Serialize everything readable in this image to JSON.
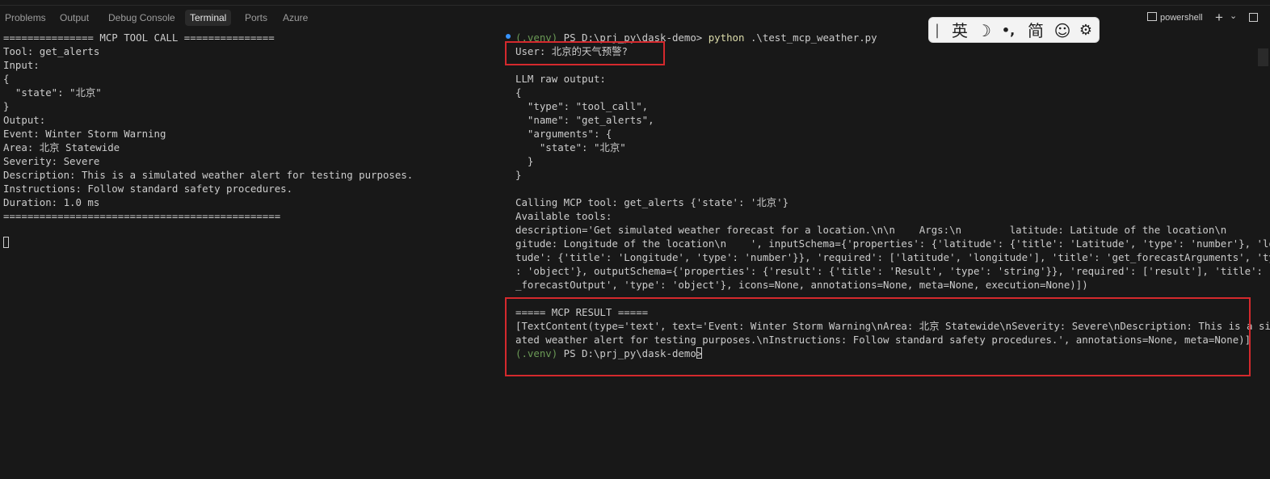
{
  "panel_tabs": [
    "Problems",
    "Output",
    "Debug Console",
    "Terminal",
    "Ports",
    "Azure"
  ],
  "toolbar": {
    "terminal_name": "powershell",
    "add_label": "+",
    "dropdown_label": "⌄",
    "layout_icon": "panel-layout-icon"
  },
  "ime": {
    "lang": "英",
    "moon": "☽",
    "punct": "•,",
    "simplified": "简",
    "emoji": "☺",
    "settings": "⚙"
  },
  "left_terminal": {
    "lines": [
      "=============== MCP TOOL CALL ===============",
      "Tool: get_alerts",
      "Input:",
      "{",
      "  \"state\": \"北京\"",
      "}",
      "Output:",
      "Event: Winter Storm Warning",
      "Area: 北京 Statewide",
      "Severity: Severe",
      "Description: This is a simulated weather alert for testing purposes.",
      "Instructions: Follow standard safety procedures.",
      "Duration: 1.0 ms",
      "=============================================="
    ]
  },
  "right_terminal": {
    "prompt_venv": "(.venv)",
    "prompt_path": " PS D:\\prj_py\\dask-demo> ",
    "command": "python",
    "command_args": " .\\test_mcp_weather.py",
    "lines": [
      "User: 北京的天气预警?",
      "",
      "LLM raw output:",
      "{",
      "  \"type\": \"tool_call\",",
      "  \"name\": \"get_alerts\",",
      "  \"arguments\": {",
      "    \"state\": \"北京\"",
      "  }",
      "}",
      "",
      "Calling MCP tool: get_alerts {'state': '北京'}",
      "Available tools:",
      "description='Get simulated weather forecast for a location.\\n\\n    Args:\\n        latitude: Latitude of the location\\n        lon",
      "gitude: Longitude of the location\\n    ', inputSchema={'properties': {'latitude': {'title': 'Latitude', 'type': 'number'}, 'longi",
      "tude': {'title': 'Longitude', 'type': 'number'}}, 'required': ['latitude', 'longitude'], 'title': 'get_forecastArguments', 'type'",
      ": 'object'}, outputSchema={'properties': {'result': {'title': 'Result', 'type': 'string'}}, 'required': ['result'], 'title': 'get",
      "_forecastOutput', 'type': 'object'}, icons=None, annotations=None, meta=None, execution=None)])",
      "",
      "===== MCP RESULT =====",
      "[TextContent(type='text', text='Event: Winter Storm Warning\\nArea: 北京 Statewide\\nSeverity: Severe\\nDescription: This is a simul",
      "ated weather alert for testing purposes.\\nInstructions: Follow standard safety procedures.', annotations=None, meta=None)]"
    ],
    "final_prompt_venv": "(.venv)",
    "final_prompt_path": " PS D:\\prj_py\\dask-demo> "
  }
}
